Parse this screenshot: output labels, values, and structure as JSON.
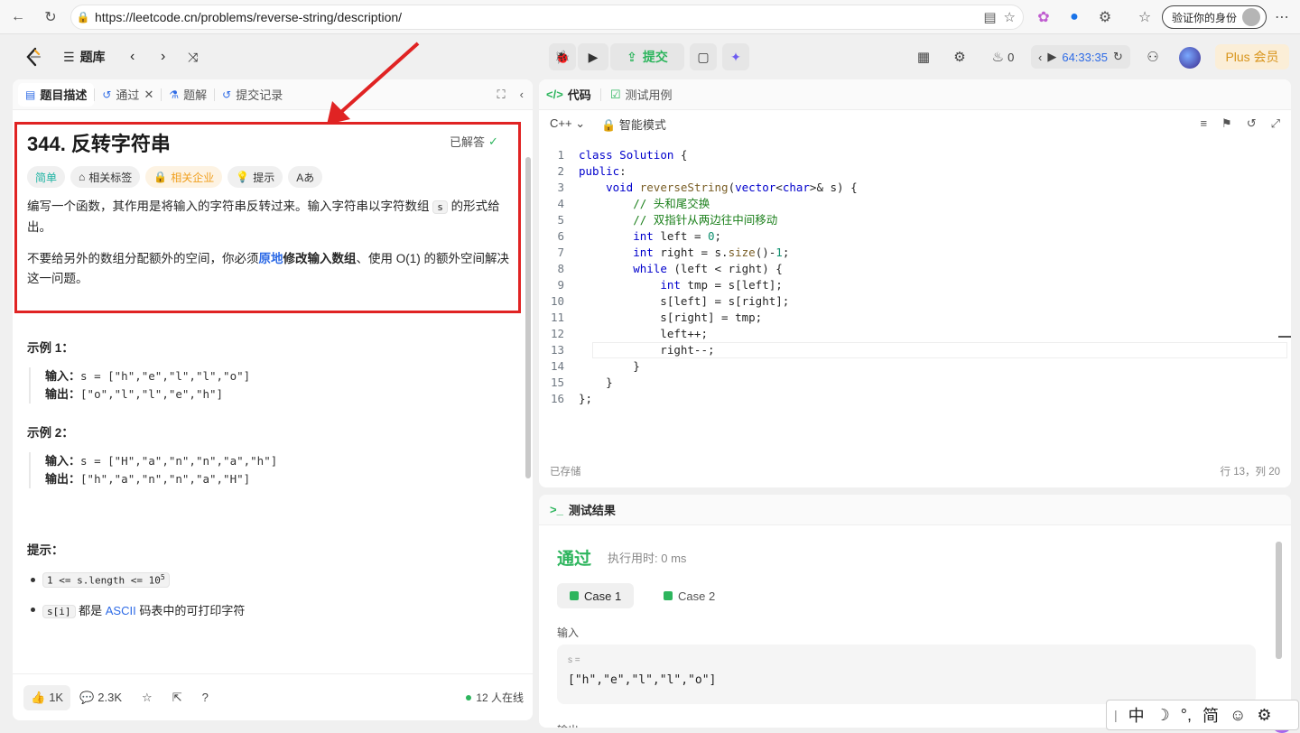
{
  "browser": {
    "url": "https://leetcode.cn/problems/reverse-string/description/",
    "verify_label": "验证你的身份"
  },
  "topnav": {
    "problemset_label": "题库",
    "submit_label": "提交",
    "streak_count": "0",
    "timer": "64:33:35",
    "plus_label": "Plus 会员"
  },
  "left_tabs": [
    {
      "label": "题目描述"
    },
    {
      "label": "通过"
    },
    {
      "label": "题解"
    },
    {
      "label": "提交记录"
    }
  ],
  "problem": {
    "title": "344. 反转字符串",
    "solved_label": "已解答",
    "tags": [
      "简单",
      "相关标签",
      "相关企业",
      "提示",
      "Aあ"
    ],
    "desc1_a": "编写一个函数，其作用是将输入的字符串反转过来。输入字符串以字符数组 ",
    "desc1_code": "s",
    "desc1_b": " 的形式给出。",
    "desc2_a": "不要给另外的数组分配额外的空间，你必须",
    "desc2_b1": "原地",
    "desc2_b2": "修改输入数组",
    "desc2_c": "、使用 O(1) 的额外空间解决这一问题。",
    "example1_title": "示例 1：",
    "example1_input_label": "输入：",
    "example1_input": "s = [\"h\",\"e\",\"l\",\"l\",\"o\"]",
    "example1_output_label": "输出：",
    "example1_output": "[\"o\",\"l\",\"l\",\"e\",\"h\"]",
    "example2_title": "示例 2：",
    "example2_input_label": "输入：",
    "example2_input": "s = [\"H\",\"a\",\"n\",\"n\",\"a\",\"h\"]",
    "example2_output_label": "输出：",
    "example2_output": "[\"h\",\"a\",\"n\",\"n\",\"a\",\"H\"]",
    "hints_title": "提示：",
    "hint1_code": "1 <= s.length <= 10",
    "hint1_sup": "5",
    "hint2_code": "s[i]",
    "hint2_a": " 都是 ",
    "hint2_link": "ASCII",
    "hint2_b": " 码表中的可打印字符"
  },
  "bottom": {
    "likes": "1K",
    "comments": "2.3K",
    "online": "12 人在线"
  },
  "editor": {
    "tab_code": "代码",
    "tab_testcase": "测试用例",
    "language": "C++",
    "mode": "智能模式",
    "status": "已存储",
    "position": "行 13，列 20",
    "line_numbers": [
      "1",
      "2",
      "3",
      "4",
      "5",
      "6",
      "7",
      "8",
      "9",
      "10",
      "11",
      "12",
      "13",
      "14",
      "15",
      "16"
    ]
  },
  "results": {
    "title": "测试结果",
    "status": "通过",
    "runtime": "执行用时: 0 ms",
    "case1": "Case 1",
    "case2": "Case 2",
    "input_label": "输入",
    "var_label": "s =",
    "input_value": "[\"h\",\"e\",\"l\",\"l\",\"o\"]",
    "output_label": "输出"
  },
  "ime": {
    "items": [
      "中",
      "☽",
      "°,",
      "简",
      "☺",
      "⚙"
    ]
  },
  "colors": {
    "accent_green": "#2db55d",
    "accent_blue": "#2e6be6",
    "highlight_red": "#e02323",
    "plus_gold": "#d8941b"
  }
}
